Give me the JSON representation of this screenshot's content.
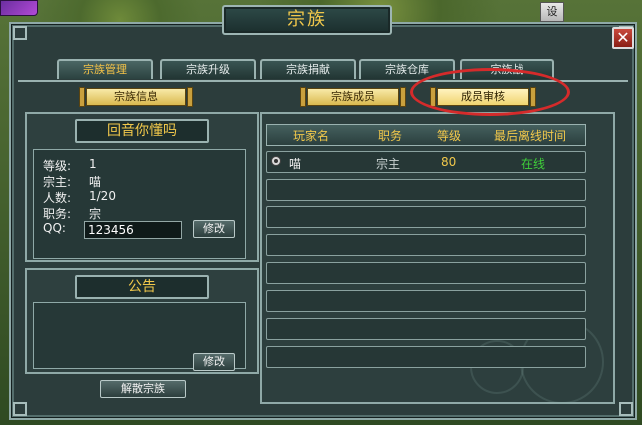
{
  "top_right_label": "设",
  "window": {
    "title": "宗族",
    "close_glyph": "✕"
  },
  "tabs": [
    {
      "label": "宗族管理",
      "active": true
    },
    {
      "label": "宗族升级",
      "active": false
    },
    {
      "label": "宗族捐献",
      "active": false
    },
    {
      "label": "宗族仓库",
      "active": false
    },
    {
      "label": "宗族战",
      "active": false
    }
  ],
  "subtabs": {
    "clan_info": "宗族信息",
    "clan_members": "宗族成员",
    "member_review": "成员审核"
  },
  "clan": {
    "name": "回音你懂吗",
    "level_label": "等级:",
    "level": "1",
    "leader_label": "宗主:",
    "leader": "喵",
    "count_label": "人数:",
    "count": "1/20",
    "position_label": "职务:",
    "position": "宗主",
    "qq_label": "QQ:",
    "qq": "123456",
    "edit_label": "修改"
  },
  "notice": {
    "title": "公告",
    "text": "",
    "edit_label": "修改",
    "disband_label": "解散宗族"
  },
  "members_table": {
    "columns": [
      "玩家名",
      "职务",
      "等级",
      "最后离线时间"
    ],
    "rows": [
      {
        "name": "喵",
        "role": "宗主",
        "level": "80",
        "last_offline": "在线"
      }
    ]
  },
  "colors": {
    "gold": "#f1c84b",
    "online": "#3fcf3a",
    "annotation": "#d52b2b"
  }
}
